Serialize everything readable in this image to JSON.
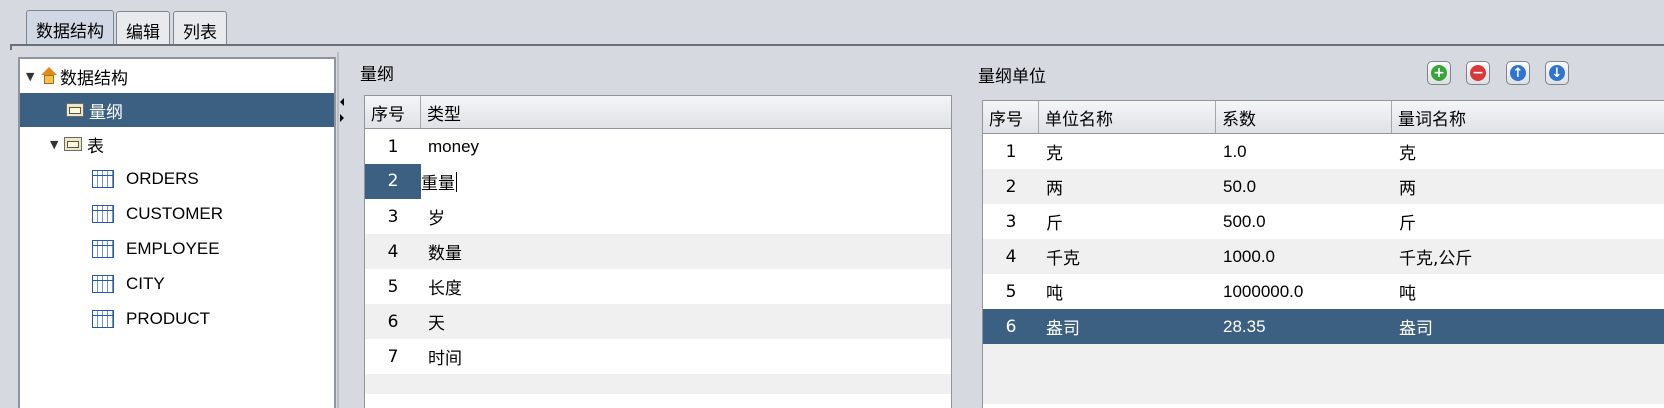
{
  "tabs": [
    {
      "label": "数据结构"
    },
    {
      "label": "编辑"
    },
    {
      "label": "列表"
    }
  ],
  "tree": {
    "root": {
      "label": "数据结构",
      "icon": "house-icon"
    },
    "items": [
      {
        "label": "量纲",
        "icon": "folder-icon",
        "selected": true
      },
      {
        "label": "表",
        "icon": "folder-icon"
      }
    ],
    "tables": [
      {
        "label": "ORDERS"
      },
      {
        "label": "CUSTOMER"
      },
      {
        "label": "EMPLOYEE"
      },
      {
        "label": "CITY"
      },
      {
        "label": "PRODUCT"
      }
    ]
  },
  "dimension_panel": {
    "title": "量纲",
    "columns": [
      "序号",
      "类型"
    ],
    "rows": [
      {
        "no": "1",
        "type": "money"
      },
      {
        "no": "2",
        "type": "重量",
        "editing": true
      },
      {
        "no": "3",
        "type": "岁"
      },
      {
        "no": "4",
        "type": "数量"
      },
      {
        "no": "5",
        "type": "长度"
      },
      {
        "no": "6",
        "type": "天"
      },
      {
        "no": "7",
        "type": "时间"
      }
    ]
  },
  "unit_panel": {
    "title": "量纲单位",
    "toolbar": {
      "add": "add-icon",
      "remove": "remove-icon",
      "up": "arrow-up-icon",
      "down": "arrow-down-icon"
    },
    "columns": [
      "序号",
      "单位名称",
      "系数",
      "量词名称"
    ],
    "rows": [
      {
        "no": "1",
        "name": "克",
        "factor": "1.0",
        "measure": "克"
      },
      {
        "no": "2",
        "name": "两",
        "factor": "50.0",
        "measure": "两"
      },
      {
        "no": "3",
        "name": "斤",
        "factor": "500.0",
        "measure": "斤"
      },
      {
        "no": "4",
        "name": "千克",
        "factor": "1000.0",
        "measure": "千克,公斤"
      },
      {
        "no": "5",
        "name": "吨",
        "factor": "1000000.0",
        "measure": "吨"
      },
      {
        "no": "6",
        "name": "盎司",
        "factor": "28.35",
        "measure": "盎司",
        "selected": true
      }
    ]
  },
  "colors": {
    "selection": "#3c6082",
    "background": "#d6d9df",
    "add": "#3aa33a",
    "remove": "#d83a3a",
    "arrow": "#2f74d0"
  }
}
